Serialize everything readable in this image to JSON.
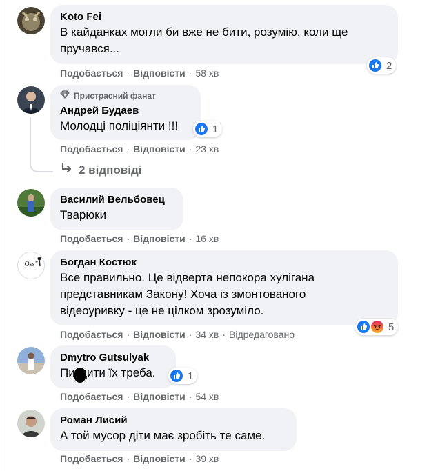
{
  "actions": {
    "like": "Подобається",
    "reply": "Відповісти",
    "sep": "·"
  },
  "colors": {
    "bubble": "#f0f2f5",
    "meta": "#65676b",
    "like": "#1877f2",
    "angry": "#e9710f"
  },
  "comments": [
    {
      "author": "Koto Fei",
      "text": [
        "В кайданках могли би вже не бити, розумію, коли ще",
        "пручався..."
      ],
      "time": "58 хв",
      "reactions": [
        "like-icon"
      ],
      "reaction_count": "2"
    },
    {
      "badge": "Пристрасний фанат",
      "badge_icon": "diamond-icon",
      "author": "Андрей Будаев",
      "text": [
        "Молодці поліціянти !!!"
      ],
      "time": "23 хв",
      "reactions": [
        "like-icon"
      ],
      "reaction_count": "1"
    },
    {
      "author": "Василий Вельбовец",
      "text": [
        "Тварюки"
      ],
      "time": "16 хв"
    },
    {
      "author": "Богдан Костюк",
      "text": [
        "Все правильно. Це відверта непокора хуліганa",
        "представникам Закону! Хоча із змонтованого",
        "відеоуривку - це не цілком зрозуміло."
      ],
      "time": "34 хв",
      "edited": "Відредаговано",
      "reactions": [
        "like-icon",
        "angry-icon"
      ],
      "reaction_count": "5",
      "avatar_text": "Oss\""
    },
    {
      "author": "Dmytro Gutsulyak",
      "text": [
        "Пиздити їх треба."
      ],
      "time": "54 хв",
      "reactions": [
        "like-icon"
      ],
      "reaction_count": "1"
    },
    {
      "author": "Роман Лисий",
      "text": [
        "А той мусор діти має зробіть те саме."
      ],
      "time": "39 хв"
    }
  ],
  "replies_label": "2 відповіді",
  "replies_icon": "reply-arrow-icon"
}
